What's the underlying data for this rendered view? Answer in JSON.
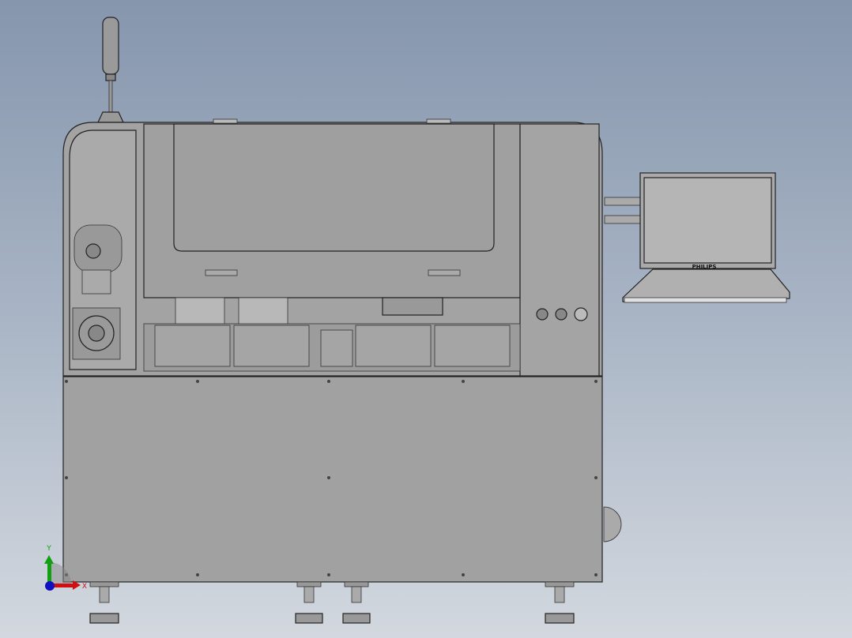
{
  "viewport": {
    "monitor_brand": "PHILIPS",
    "triad": {
      "x_label": "X",
      "y_label": "Y",
      "x_color": "#d01010",
      "y_color": "#10a010",
      "z_color": "#1010c0"
    }
  },
  "colors": {
    "body": "#a3a3a3",
    "panel": "#9e9e9e",
    "screen": "#b5b5b5"
  }
}
